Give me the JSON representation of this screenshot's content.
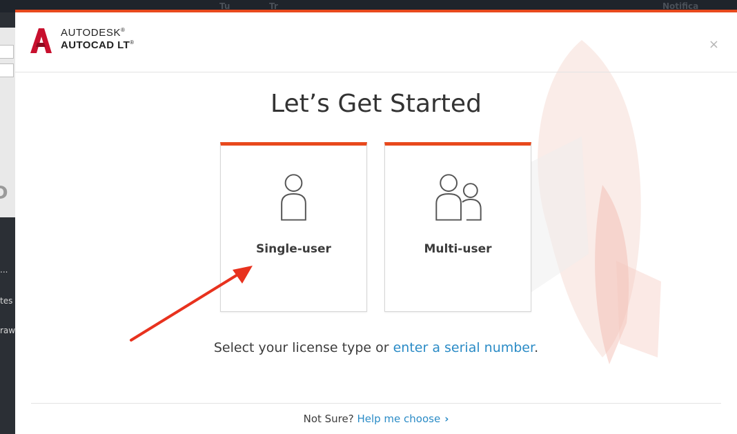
{
  "background_app": {
    "topbar_texts": [
      "Tu",
      "Tr",
      "Notifica"
    ],
    "left_big_text": "D",
    "left_labels": [
      "...",
      "tes",
      "raw"
    ]
  },
  "dialog": {
    "brand": {
      "company": "AUTODESK",
      "product": "AUTOCAD LT",
      "company_mark": "®",
      "product_mark": "®"
    },
    "close_label": "×",
    "title": "Let’s Get Started",
    "options": [
      {
        "label": "Single-user",
        "icon": "single-user-icon"
      },
      {
        "label": "Multi-user",
        "icon": "multi-user-icon"
      }
    ],
    "instruction": {
      "prefix": "Select your license type or ",
      "link": "enter a serial number",
      "suffix": "."
    },
    "footer": {
      "prefix": "Not Sure? ",
      "link": "Help me choose",
      "chevron": "›"
    }
  },
  "colors": {
    "accent": "#e8491d",
    "link": "#2a8bc6",
    "annotation_arrow": "#e8321e"
  }
}
